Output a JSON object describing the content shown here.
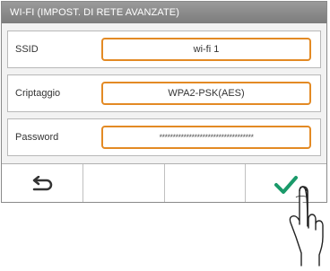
{
  "title": "WI-FI (IMPOST. DI RETE AVANZATE)",
  "fields": [
    {
      "label": "SSID",
      "value": "wi-fi 1"
    },
    {
      "label": "Criptaggio",
      "value": "WPA2-PSK(AES)"
    },
    {
      "label": "Password",
      "value": "***********************************"
    }
  ],
  "bottom_buttons": [
    {
      "icon": "back-arrow-icon"
    },
    {
      "icon": ""
    },
    {
      "icon": ""
    },
    {
      "icon": "checkmark-icon"
    }
  ],
  "colors": {
    "accent": "#e38a24",
    "confirm": "#1a9a6a",
    "title_bar": "#8a8a8a"
  }
}
